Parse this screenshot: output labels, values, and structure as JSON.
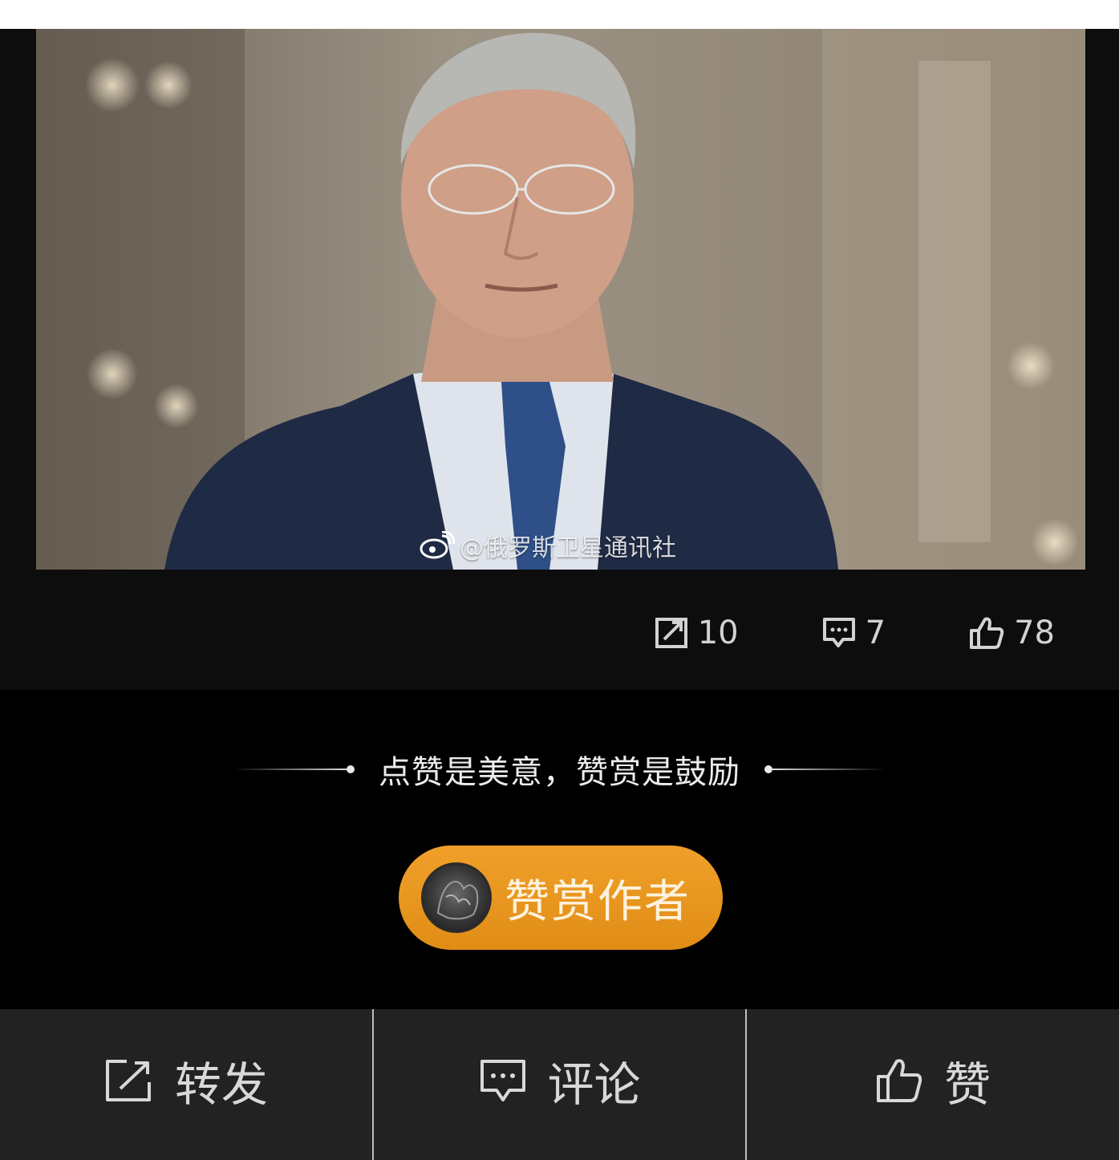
{
  "post": {
    "watermark": "@俄罗斯卫星通讯社",
    "stats": {
      "repost_count": "10",
      "comment_count": "7",
      "like_count": "78"
    }
  },
  "reward": {
    "tagline": "点赞是美意，赞赏是鼓励",
    "button_label": "赞赏作者",
    "accent_color": "#e8951f"
  },
  "bottom_bar": {
    "repost_label": "转发",
    "comment_label": "评论",
    "like_label": "赞"
  },
  "icons": [
    "weibo-logo-icon",
    "repost-icon",
    "comment-icon",
    "like-icon"
  ]
}
